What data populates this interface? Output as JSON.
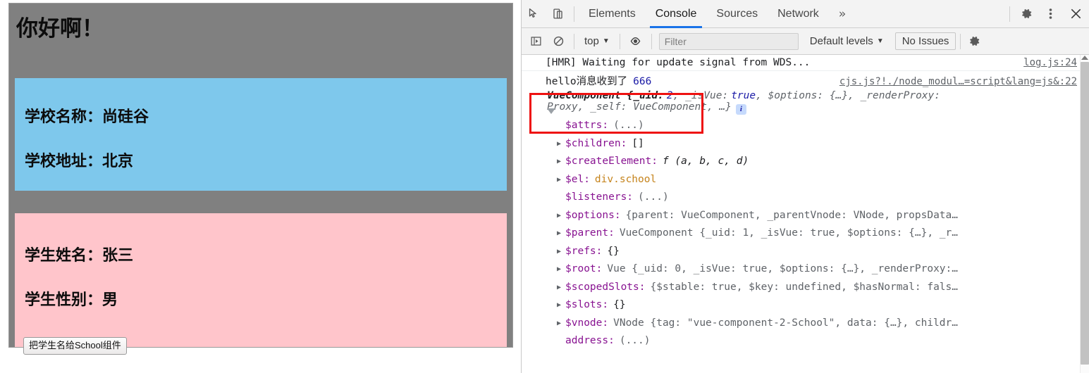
{
  "page": {
    "greeting": "你好啊！",
    "school": {
      "name_line": "学校名称：尚硅谷",
      "address_line": "学校地址：北京"
    },
    "student": {
      "name_line": "学生姓名：张三",
      "gender_line": "学生性别：男",
      "button_label": "把学生名给School组件"
    },
    "colors": {
      "container_bg": "#808080",
      "school_bg": "#7ec8ec",
      "student_bg": "#ffc5cb"
    }
  },
  "devtools": {
    "tabs": [
      {
        "label": "Elements",
        "active": false
      },
      {
        "label": "Console",
        "active": true
      },
      {
        "label": "Sources",
        "active": false
      },
      {
        "label": "Network",
        "active": false
      }
    ],
    "more_label": "»",
    "icons": {
      "inspect": "inspect-element-icon",
      "device": "device-toolbar-icon",
      "settings": "gear-icon",
      "kebab": "more-options-icon",
      "close": "close-icon"
    },
    "filterbar": {
      "sidebar_toggle": "console-sidebar-icon",
      "clear": "clear-console-icon",
      "context": "top",
      "context_caret": "▼",
      "eye": "live-expression-icon",
      "filter_placeholder": "Filter",
      "filter_value": "",
      "levels": "Default levels",
      "levels_caret": "▼",
      "issues": "No Issues",
      "settings": "gear-icon"
    },
    "accent": "#1a73e8"
  },
  "console": {
    "messages": [
      {
        "text": "[HMR] Waiting for update signal from WDS...",
        "source": "log.js:24"
      },
      {
        "text": "hello消息收到了",
        "number": "666",
        "source": "cjs.js?!./node_modul…=script&lang=js&:22"
      }
    ],
    "object": {
      "header": "VueComponent {_uid:",
      "header_rest_uid": "2",
      "header_isvue_key": ", _isVue:",
      "header_isvue_val": "true",
      "header_options": ", $options: {…}, _renderProxy:",
      "preview_line2": "Proxy, _self: VueComponent, …}",
      "info_badge": "i",
      "properties": [
        {
          "expandable": false,
          "key": "$attrs:",
          "value": "(...)",
          "value_kind": "ellipsis"
        },
        {
          "expandable": true,
          "key": "$children:",
          "value": "[]",
          "value_kind": "plain"
        },
        {
          "expandable": true,
          "key": "$createElement:",
          "value": "f (a, b, c, d)",
          "value_kind": "fn"
        },
        {
          "expandable": true,
          "key": "$el:",
          "value": "div.school",
          "value_kind": "element"
        },
        {
          "expandable": false,
          "key": "$listeners:",
          "value": "(...)",
          "value_kind": "ellipsis"
        },
        {
          "expandable": true,
          "key": "$options:",
          "value": "{parent: VueComponent, _parentVnode: VNode, propsData…",
          "value_kind": "objpreview"
        },
        {
          "expandable": true,
          "key": "$parent:",
          "value": "VueComponent {_uid: 1, _isVue: true, $options: {…}, _r…",
          "value_kind": "objpreview"
        },
        {
          "expandable": true,
          "key": "$refs:",
          "value": "{}",
          "value_kind": "plain"
        },
        {
          "expandable": true,
          "key": "$root:",
          "value": "Vue {_uid: 0, _isVue: true, $options: {…}, _renderProxy:…",
          "value_kind": "objpreview"
        },
        {
          "expandable": true,
          "key": "$scopedSlots:",
          "value": "{$stable: true, $key: undefined, $hasNormal: fals…",
          "value_kind": "objpreview"
        },
        {
          "expandable": true,
          "key": "$slots:",
          "value": "{}",
          "value_kind": "plain"
        },
        {
          "expandable": true,
          "key": "$vnode:",
          "value": "VNode {tag: \"vue-component-2-School\", data: {…}, childr…",
          "value_kind": "objpreview"
        },
        {
          "expandable": false,
          "key": "address:",
          "value": "(...)",
          "value_kind": "ellipsis"
        }
      ]
    },
    "highlight_color": "#ee1111"
  }
}
